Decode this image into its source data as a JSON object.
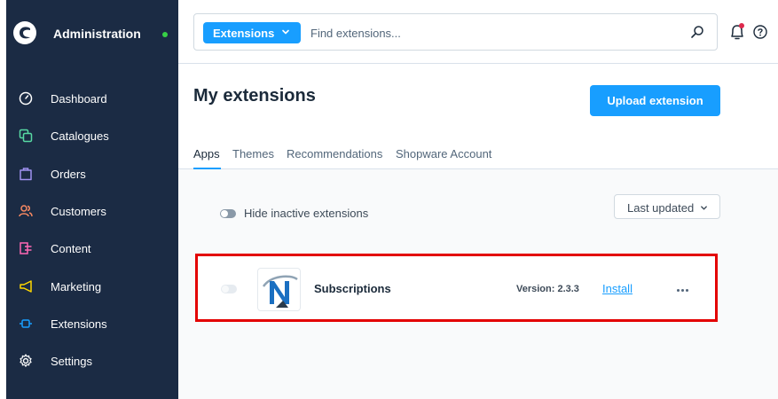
{
  "sidebar": {
    "title": "Administration",
    "status_color": "#37d046",
    "items": [
      {
        "label": "Dashboard",
        "icon": "dashboard-icon",
        "color": "#ffffff"
      },
      {
        "label": "Catalogues",
        "icon": "catalogues-icon",
        "color": "#57d9a3"
      },
      {
        "label": "Orders",
        "icon": "orders-icon",
        "color": "#a092f0"
      },
      {
        "label": "Customers",
        "icon": "customers-icon",
        "color": "#f88962"
      },
      {
        "label": "Content",
        "icon": "content-icon",
        "color": "#ff68b4"
      },
      {
        "label": "Marketing",
        "icon": "marketing-icon",
        "color": "#ffd700"
      },
      {
        "label": "Extensions",
        "icon": "extensions-icon",
        "color": "#189eff"
      },
      {
        "label": "Settings",
        "icon": "settings-icon",
        "color": "#ffffff"
      }
    ]
  },
  "topbar": {
    "search_type": "Extensions",
    "search_placeholder": "Find extensions..."
  },
  "page": {
    "title": "My extensions",
    "upload_button": "Upload extension",
    "tabs": [
      {
        "label": "Apps",
        "active": true
      },
      {
        "label": "Themes",
        "active": false
      },
      {
        "label": "Recommendations",
        "active": false
      },
      {
        "label": "Shopware Account",
        "active": false
      }
    ]
  },
  "filters": {
    "hide_inactive_label": "Hide inactive extensions",
    "sort_label": "Last updated"
  },
  "extensions": [
    {
      "name": "Subscriptions",
      "version": "Version: 2.3.3",
      "action": "Install",
      "highlight_color": "#e30000"
    }
  ],
  "colors": {
    "sidebar_bg": "#1b2b44",
    "accent": "#189eff"
  }
}
